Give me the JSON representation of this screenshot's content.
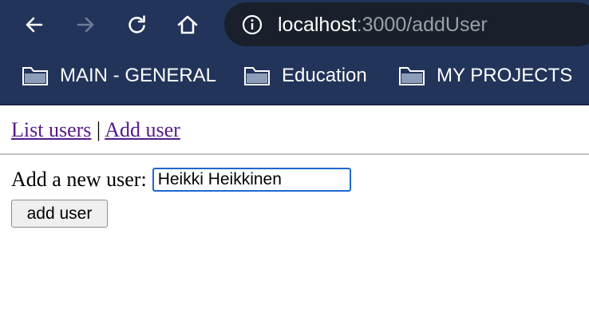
{
  "browser": {
    "back_icon": "arrow-left-icon",
    "forward_icon": "arrow-right-icon",
    "reload_icon": "reload-icon",
    "home_icon": "home-icon",
    "info_icon": "info-icon",
    "url_host": "localhost",
    "url_rest": ":3000/addUser",
    "colors": {
      "toolbar": "#22345a",
      "omnibox": "#19202b"
    }
  },
  "bookmarks": [
    {
      "label": "MAIN - GENERAL",
      "icon": "folder-icon"
    },
    {
      "label": "Education",
      "icon": "folder-icon"
    },
    {
      "label": "MY PROJECTS",
      "icon": "folder-icon"
    }
  ],
  "page": {
    "nav": {
      "list_users": "List users",
      "separator": "|",
      "add_user": "Add user"
    },
    "form": {
      "label": "Add a new user:",
      "input_value": "Heikki Heikkinen",
      "submit_label": "add user"
    },
    "colors": {
      "visited_link": "#551a8b",
      "input_focus": "#1f67d2"
    }
  }
}
